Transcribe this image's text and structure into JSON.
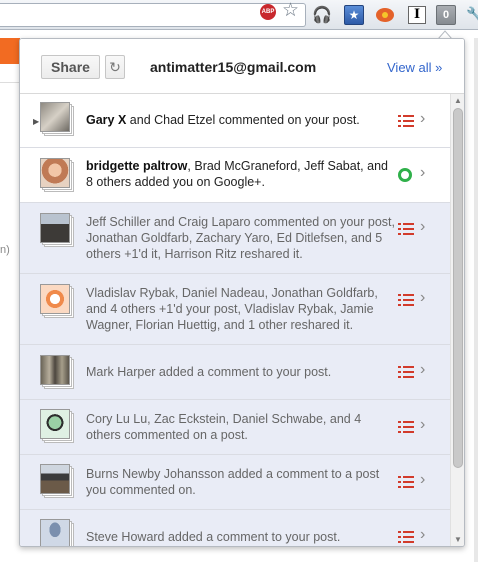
{
  "toolbar": {
    "abp_label": "ABP",
    "notification_count": "0",
    "extension_i_label": "I"
  },
  "background_page": {
    "edge_text": "n)"
  },
  "popup": {
    "share_label": "Share",
    "account_email": "antimatter15@gmail.com",
    "view_all_label": "View all »",
    "notifications": [
      {
        "actor": "Gary X",
        "text": " and Chad Etzel commented on your post.",
        "state": "unread",
        "action_icon": "list-icon",
        "avatar": "cat"
      },
      {
        "actor": "bridgette paltrow",
        "text": ", Brad McGraneford, Jeff Sabat, and 8 others added you on Google+.",
        "state": "unread",
        "action_icon": "circle-icon",
        "avatar": "woman"
      },
      {
        "actor": "",
        "text": "Jeff Schiller and Craig Laparo commented on your post, Jonathan Goldfarb, Zachary Yaro, Ed Ditlefsen, and 5 others +1'd it, Harrison Ritz reshared it.",
        "state": "read",
        "action_icon": "list-icon",
        "avatar": "man-suit"
      },
      {
        "actor": "",
        "text": "Vladislav Rybak, Daniel Nadeau, Jonathan Goldfarb, and 4 others +1'd your post, Vladislav Rybak, Jamie Wagner, Florian Huettig, and 1 other reshared it.",
        "state": "read",
        "action_icon": "list-icon",
        "avatar": "orange-sketch"
      },
      {
        "actor": "",
        "text": "Mark Harper added a comment to your post.",
        "state": "read",
        "action_icon": "list-icon",
        "avatar": "group"
      },
      {
        "actor": "",
        "text": "Cory Lu Lu, Zac Eckstein, Daniel Schwabe, and 4 others commented on a post.",
        "state": "read",
        "action_icon": "list-icon",
        "avatar": "cartoon"
      },
      {
        "actor": "",
        "text": "Burns Newby Johansson added a comment to a post you commented on.",
        "state": "read",
        "action_icon": "list-icon",
        "avatar": "man-cap"
      },
      {
        "actor": "",
        "text": "Steve Howard added a comment to your post.",
        "state": "read",
        "action_icon": "list-icon",
        "avatar": "silhouette"
      }
    ]
  },
  "colors": {
    "accent_link": "#3366cc",
    "unread_bg": "#ffffff",
    "read_bg": "#e9ecf6",
    "list_icon_red": "#d23b2b",
    "circle_green": "#2fb04a"
  }
}
